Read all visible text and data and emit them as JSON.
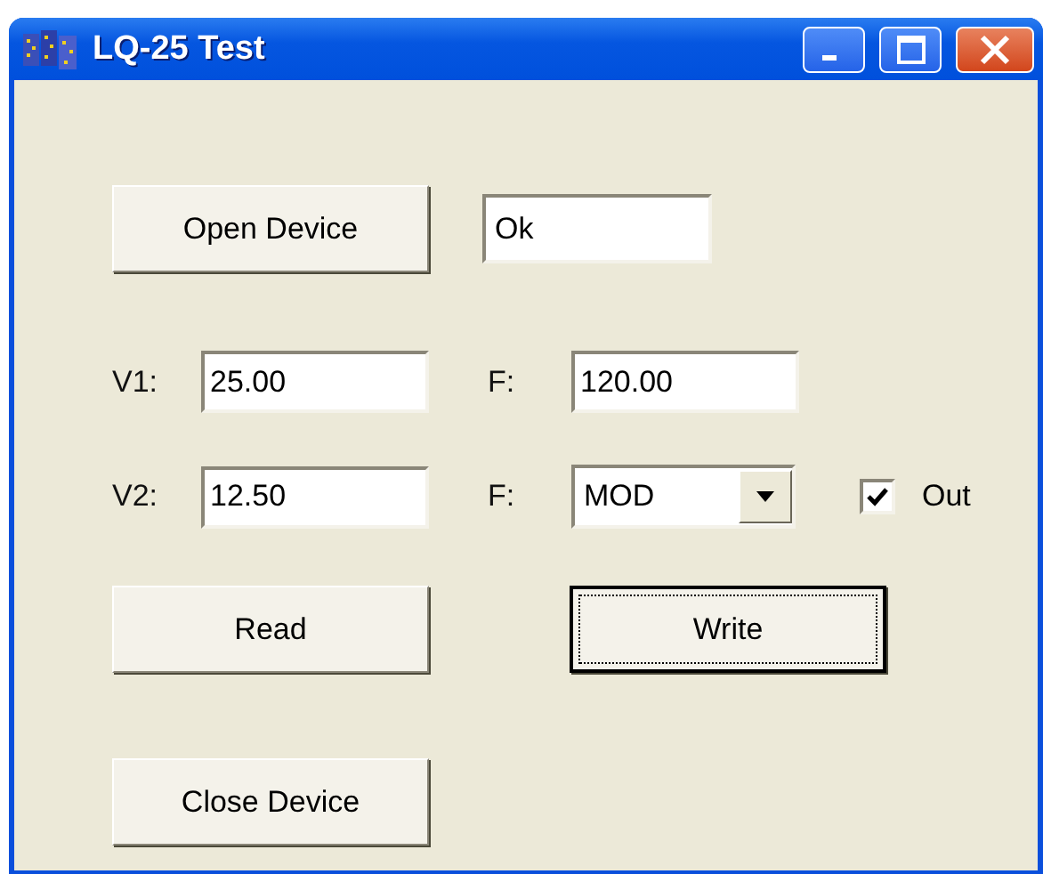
{
  "window": {
    "title": "LQ-25 Test"
  },
  "open_button": {
    "label": "Open Device",
    "focused": false
  },
  "status_field": {
    "value": "Ok"
  },
  "row_1": {
    "v_label": "V1:",
    "v_value": "25.00",
    "f_label": "F:",
    "f_value": "120.00"
  },
  "row_2": {
    "v_label": "V2:",
    "v_value": "12.50",
    "f_label": "F:",
    "f_value": "MOD"
  },
  "out_checkbox": {
    "label": "Out",
    "checked": true
  },
  "read_button": {
    "label": "Read",
    "focused": false
  },
  "write_button": {
    "label": "Write",
    "focused": true
  },
  "close_button": {
    "label": "Close Device",
    "focused": false
  }
}
